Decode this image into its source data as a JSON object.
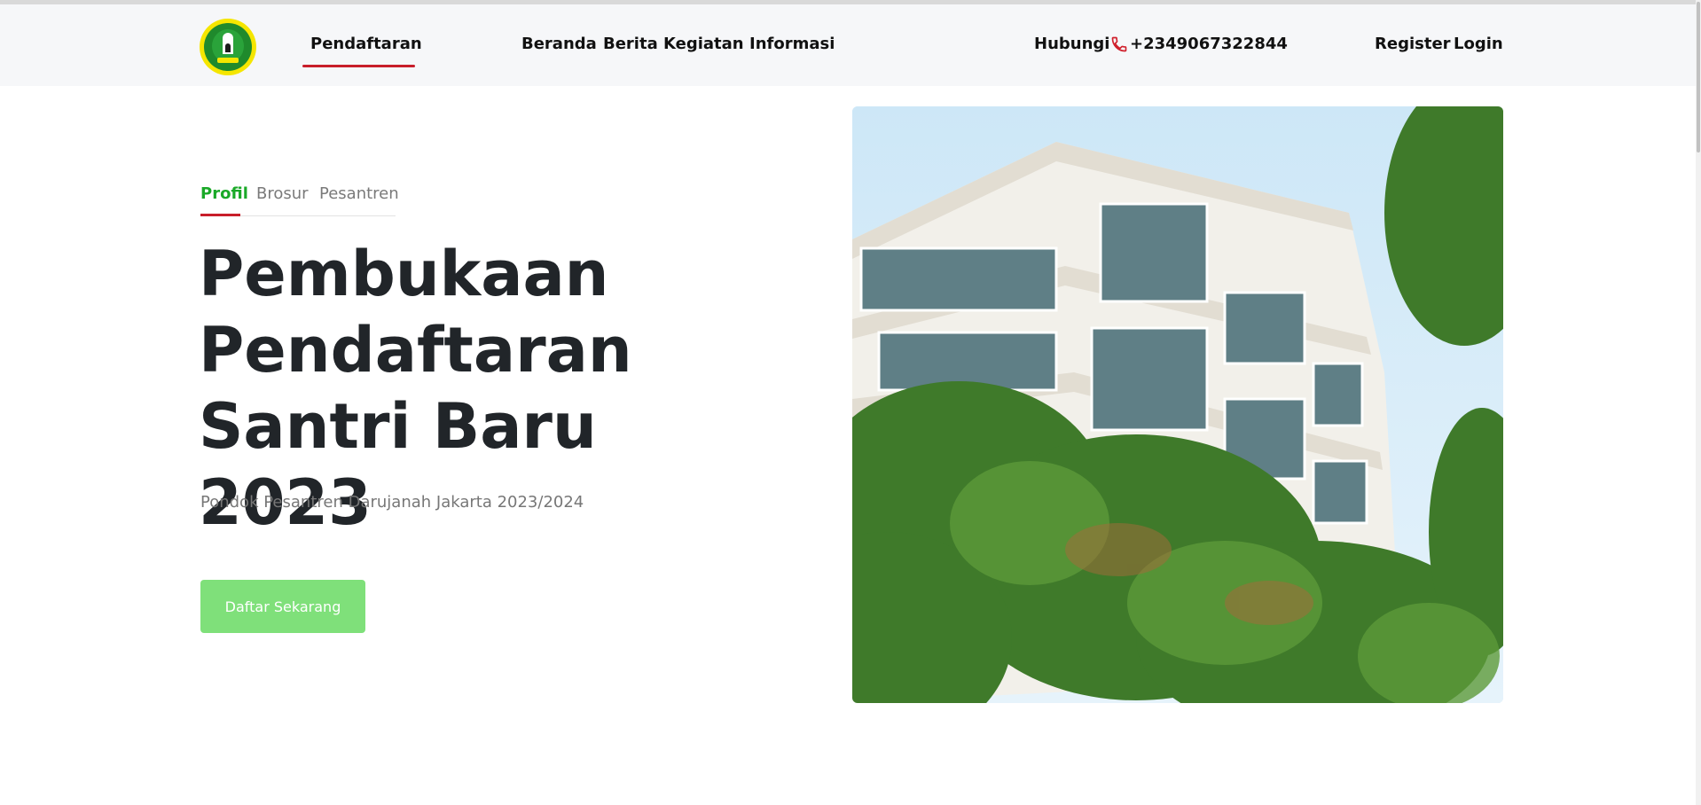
{
  "nav": {
    "active": "Pendaftaran",
    "links": [
      "Beranda",
      "Berita",
      "Kegiatan",
      "Informasi"
    ],
    "contact_label": "Hubungi",
    "phone": "+2349067322844",
    "register": "Register",
    "login": "Login"
  },
  "hero": {
    "tabs": [
      "Profil",
      "Brosur",
      "Pesantren"
    ],
    "active_tab": "Profil",
    "headline_lines": [
      "Pembukaan",
      "Pendaftaran",
      "Santri Baru 2023"
    ],
    "subtitle": "Pondok Pesantren Darujanah Jakarta 2023/2024",
    "cta": "Daftar Sekarang"
  },
  "colors": {
    "accent_green": "#1aa928",
    "cta_green": "#7fe07a",
    "underline_red": "#c81e2a",
    "navbar_bg": "#f6f7f9"
  },
  "icons": {
    "logo": "school-emblem-icon",
    "phone": "phone-icon"
  }
}
